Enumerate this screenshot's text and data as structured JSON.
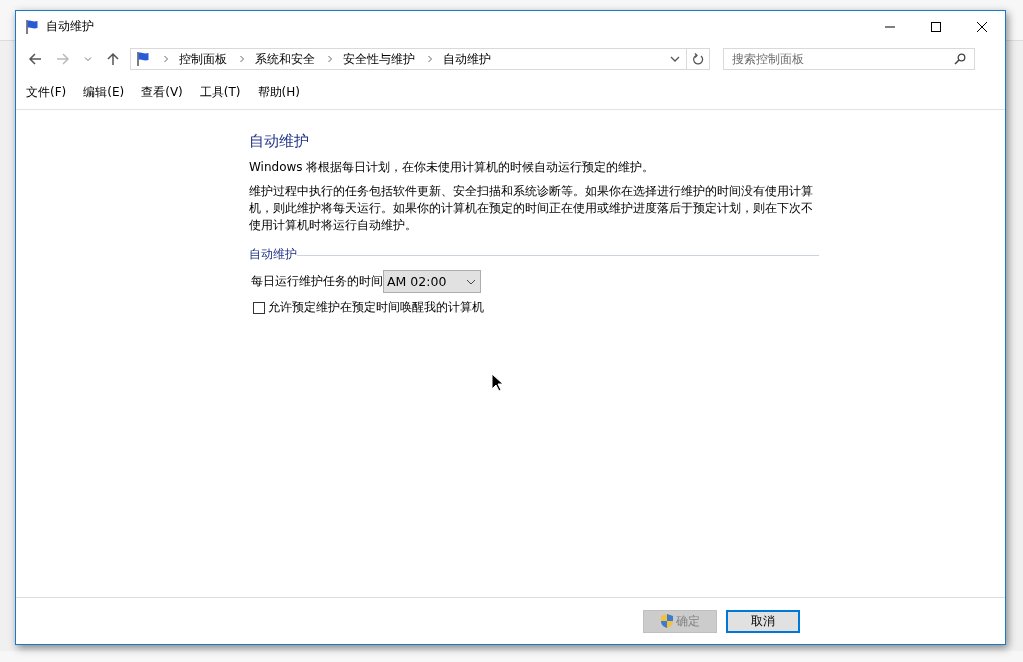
{
  "window": {
    "title": "自动维护"
  },
  "breadcrumb": [
    "控制面板",
    "系统和安全",
    "安全性与维护",
    "自动维护"
  ],
  "search": {
    "placeholder": "搜索控制面板"
  },
  "menu": [
    "文件(F)",
    "编辑(E)",
    "查看(V)",
    "工具(T)",
    "帮助(H)"
  ],
  "heading": "自动维护",
  "paragraphs": [
    "Windows 将根据每日计划，在你未使用计算机的时候自动运行预定的维护。",
    "维护过程中执行的任务包括软件更新、安全扫描和系统诊断等。如果你在选择进行维护的时间没有使用计算机，则此维护将每天运行。如果你的计算机在预定的时间正在使用或维护进度落后于预定计划，则在下次不使用计算机时将运行自动维护。"
  ],
  "section": {
    "title": "自动维护",
    "time_label": "每日运行维护任务的时间",
    "time_value": "AM 02:00",
    "wake_checkbox": {
      "label": "允许预定维护在预定时间唤醒我的计算机",
      "checked": false
    }
  },
  "buttons": [
    {
      "label": "确定",
      "disabled": true,
      "focused": false,
      "shield": true
    },
    {
      "label": "取消",
      "disabled": false,
      "focused": true,
      "shield": false
    }
  ]
}
